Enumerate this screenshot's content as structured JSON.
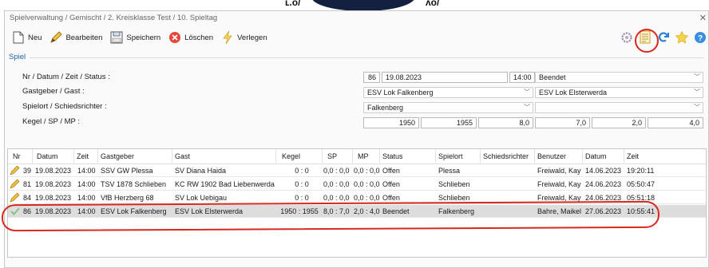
{
  "window": {
    "breadcrumb": "Spielverwaltung / Gemischt / 2. Kreisklasse Test / 10. Spieltag",
    "close_glyph": "✕"
  },
  "toolbar": {
    "new_label": "Neu",
    "edit_label": "Bearbeiten",
    "save_label": "Speichern",
    "delete_label": "Löschen",
    "move_label": "Verlegen",
    "icons": [
      "gear-icon",
      "report-icon",
      "refresh-icon",
      "star-icon",
      "help-icon"
    ]
  },
  "form": {
    "section": "Spiel",
    "labels": {
      "nr": "Nr / Datum / Zeit / Status :",
      "teams": "Gastgeber / Gast :",
      "venue": "Spielort / Schiedsrichter :",
      "scores": "Kegel / SP / MP :"
    },
    "nr": "86",
    "date": "19.08.2023",
    "time": "14:00",
    "status": "Beendet",
    "home": "ESV Lok Falkenberg",
    "guest": "ESV Lok Elsterwerda",
    "venue": "Falkenberg",
    "referee": "",
    "kegel_home": "1950",
    "kegel_guest": "1955",
    "sp_home": "8,0",
    "sp_guest": "7,0",
    "mp_home": "2,0",
    "mp_guest": "4,0"
  },
  "table": {
    "columns": [
      "Nr",
      "Datum",
      "Zeit",
      "Gastgeber",
      "Gast",
      "Kegel",
      "SP",
      "MP",
      "Status",
      "Spielort",
      "Schiedsrichter",
      "Benutzer",
      "Datum",
      "Zeit"
    ],
    "rows": [
      {
        "icon": "pencil-icon",
        "nr": "39",
        "date": "19.08.2023",
        "time": "14:00",
        "home": "SSV GW Plessa",
        "guest": "SV Diana Haida",
        "kegel": "0 : 0",
        "sp": "0,0 : 0,0",
        "mp": "0,0 : 0,0",
        "status": "Offen",
        "venue": "Plessa",
        "referee": "",
        "user": "Freiwald, Kay",
        "udate": "14.06.2023",
        "utime": "19:20:11"
      },
      {
        "icon": "pencil-icon",
        "nr": "81",
        "date": "19.08.2023",
        "time": "14:00",
        "home": "TSV 1878 Schlieben",
        "guest": "KC RW 1902 Bad Liebenwerda",
        "kegel": "0 : 0",
        "sp": "0,0 : 0,0",
        "mp": "0,0 : 0,0",
        "status": "Offen",
        "venue": "Schlieben",
        "referee": "",
        "user": "Freiwald, Kay",
        "udate": "24.06.2023",
        "utime": "05:50:47"
      },
      {
        "icon": "pencil-icon",
        "nr": "84",
        "date": "19.08.2023",
        "time": "14:00",
        "home": "VfB Herzberg 68",
        "guest": "SV Lok Uebigau",
        "kegel": "0 : 0",
        "sp": "0,0 : 0,0",
        "mp": "0,0 : 0,0",
        "status": "Offen",
        "venue": "Schlieben",
        "referee": "",
        "user": "Freiwald, Kay",
        "udate": "24.06.2023",
        "utime": "05:51:18"
      },
      {
        "icon": "check-icon",
        "nr": "86",
        "date": "19.08.2023",
        "time": "14:00",
        "home": "ESV Lok Falkenberg",
        "guest": "ESV Lok Elsterwerda",
        "kegel": "1950 : 1955",
        "sp": "8,0 : 7,0",
        "mp": "2,0 : 4,0",
        "status": "Beendet",
        "venue": "Falkenberg",
        "referee": "",
        "user": "Bahre, Maikel",
        "udate": "27.06.2023",
        "utime": "10:55:41"
      }
    ]
  },
  "colors": {
    "section_title": "#1e5fb4",
    "annotation": "#d8281f",
    "selected_row": "#dddddd"
  }
}
